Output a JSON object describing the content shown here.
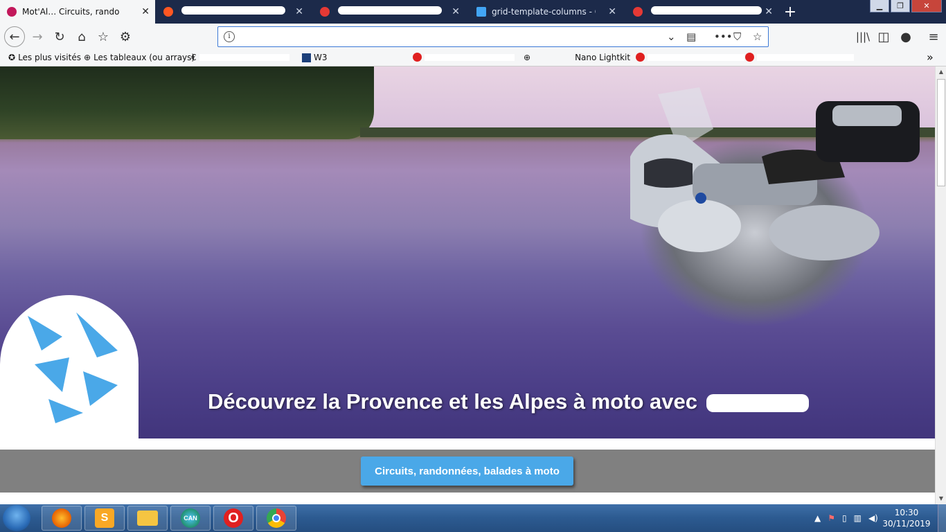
{
  "browser": {
    "tabs": [
      {
        "title": "Mot'Al… Circuits, rando",
        "active": true,
        "color": "#c2185b"
      },
      {
        "title": "",
        "active": false,
        "color": "#ff5722"
      },
      {
        "title": "",
        "active": false,
        "color": "#e53935"
      },
      {
        "title": "grid-template-columns - CSS",
        "active": false,
        "color": "#42a5f5"
      },
      {
        "title": "",
        "active": false,
        "color": "#e53935"
      }
    ],
    "new_tab_label": "+",
    "url": "",
    "bookmarks": [
      {
        "label": "Les plus visités",
        "icon": "star-icon"
      },
      {
        "label": "Les tableaux (ou arrays)",
        "icon": "globe-icon"
      },
      {
        "label": "",
        "icon": "euro-icon"
      },
      {
        "label": "W3",
        "icon": "bookmark-icon"
      },
      {
        "label": "",
        "icon": "pinterest-icon"
      },
      {
        "label": "Nano Lightkit",
        "icon": "globe-icon"
      },
      {
        "label": "",
        "icon": "pinterest-icon"
      }
    ]
  },
  "page": {
    "hero_title": "Découvrez la Provence et les Alpes à moto avec",
    "cta_label": "Circuits, randonnées, balades à moto"
  },
  "taskbar": {
    "apps": [
      {
        "name": "firefox",
        "glyph": "",
        "color": "#e66000"
      },
      {
        "name": "sublime-text",
        "glyph": "S",
        "color": "#f9a825"
      },
      {
        "name": "file-explorer",
        "glyph": "",
        "color": "#f5c542"
      },
      {
        "name": "edge-can",
        "glyph": "CAN",
        "color": "#1b8a5a"
      },
      {
        "name": "opera",
        "glyph": "O",
        "color": "#e02020"
      },
      {
        "name": "chrome",
        "glyph": "",
        "color": "#4285f4"
      }
    ],
    "clock_time": "10:30",
    "clock_date": "30/11/2019"
  },
  "colors": {
    "accent": "#4aa8e8",
    "band": "#808080",
    "tabbar": "#1c2a4a"
  }
}
